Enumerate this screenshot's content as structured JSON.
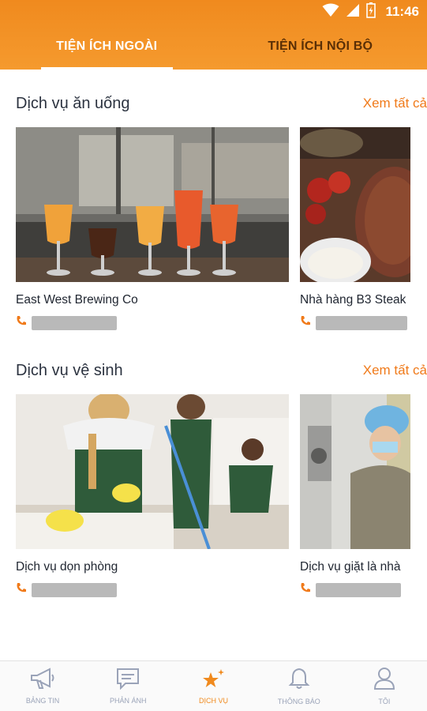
{
  "status_bar": {
    "time": "11:46"
  },
  "tabs": [
    {
      "label": "TIỆN ÍCH NGOÀI",
      "active": true
    },
    {
      "label": "TIỆN ÍCH NỘI BỘ",
      "active": false
    }
  ],
  "sections": [
    {
      "title": "Dịch vụ ăn uống",
      "see_all": "Xem tất cả",
      "cards": [
        {
          "name": "East West Brewing Co",
          "image": "beer-glasses-photo"
        },
        {
          "name": "Nhà hàng B3 Steak",
          "image": "steak-dish-photo"
        }
      ]
    },
    {
      "title": "Dịch vụ vệ sinh",
      "see_all": "Xem tất cả",
      "cards": [
        {
          "name": "Dịch vụ dọn phòng",
          "image": "cleaning-staff-photo"
        },
        {
          "name": "Dịch vụ giặt là nhà",
          "image": "laundry-worker-photo"
        }
      ]
    }
  ],
  "bottom_nav": [
    {
      "label": "BẢNG TIN",
      "icon": "megaphone-icon"
    },
    {
      "label": "PHẢN ÁNH",
      "icon": "chat-icon"
    },
    {
      "label": "DỊCH VỤ",
      "icon": "stars-icon",
      "active": true
    },
    {
      "label": "THÔNG BÁO",
      "icon": "bell-icon"
    },
    {
      "label": "TÔI",
      "icon": "user-icon"
    }
  ],
  "colors": {
    "accent": "#f08a1e",
    "title": "#2c3340",
    "nav_inactive": "#9aa3b8"
  }
}
